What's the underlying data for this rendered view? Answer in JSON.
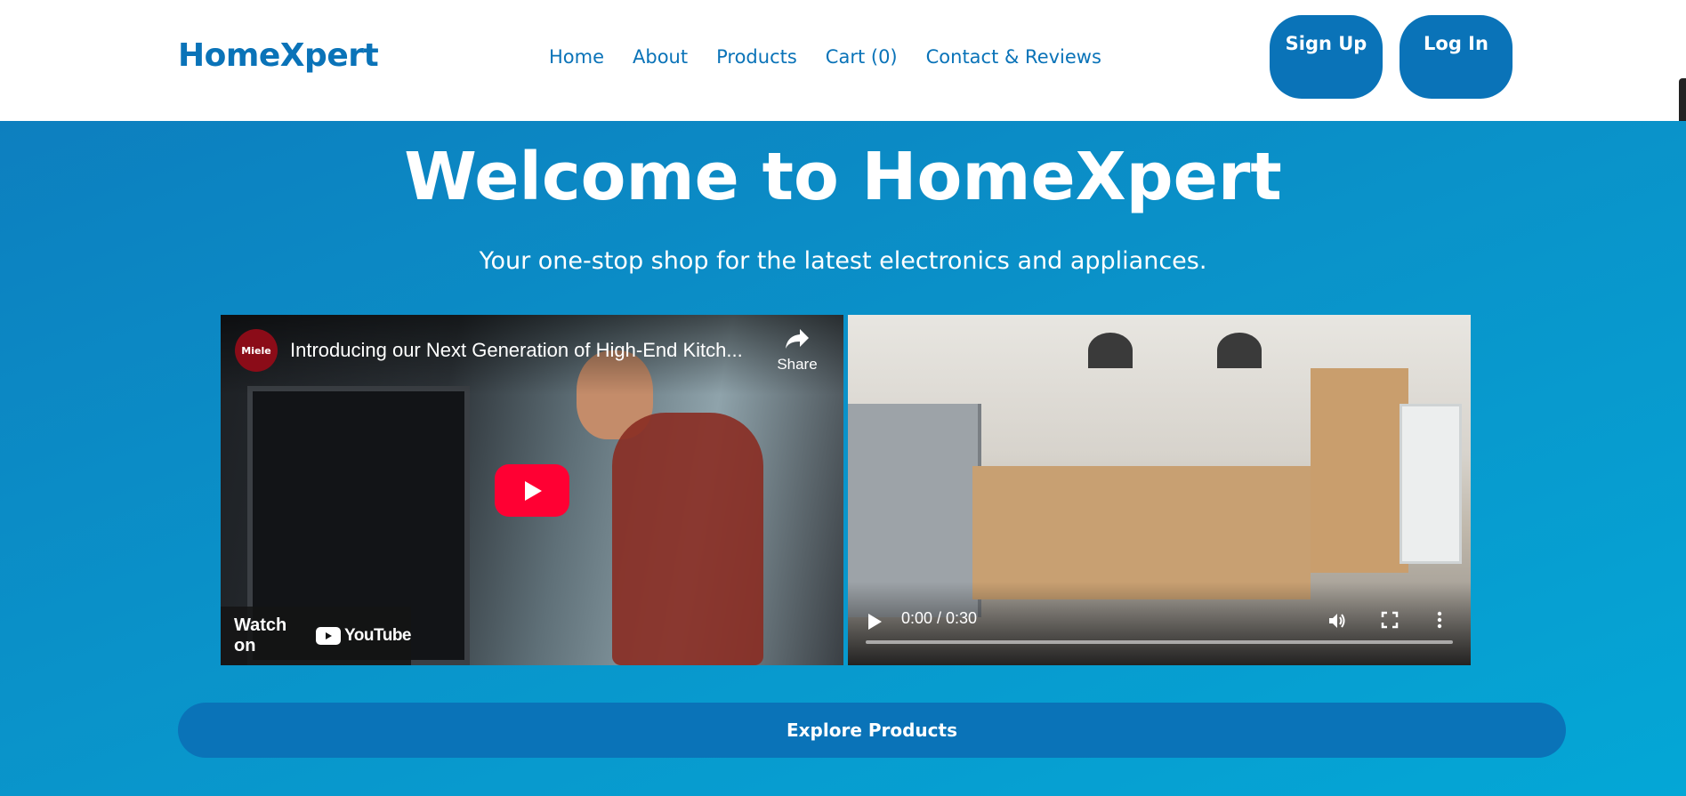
{
  "header": {
    "logo": "HomeXpert",
    "nav": [
      "Home",
      "About",
      "Products",
      "Cart (0)",
      "Contact & Reviews"
    ],
    "signup_label": "Sign Up",
    "login_label": "Log In"
  },
  "hero": {
    "title": "Welcome to HomeXpert",
    "subtitle": "Your one-stop shop for the latest electronics and appliances."
  },
  "youtube_video": {
    "channel_avatar_text": "Miele",
    "title": "Introducing our Next Generation of High-End Kitch...",
    "share_label": "Share",
    "watch_on_label": "Watch on",
    "youtube_logo_text": "YouTube",
    "icons": [
      "share-icon",
      "youtube-play-icon",
      "youtube-logo-icon"
    ]
  },
  "native_video": {
    "time": "0:00 / 0:30",
    "progress": 0,
    "icons": [
      "play-icon",
      "volume-icon",
      "fullscreen-icon",
      "more-options-icon"
    ]
  },
  "cta": {
    "label": "Explore Products"
  },
  "colors": {
    "brand": "#0a73b8",
    "hero_start": "#0d7fbf",
    "hero_end": "#04a7d6",
    "youtube_red": "#ff0033"
  }
}
